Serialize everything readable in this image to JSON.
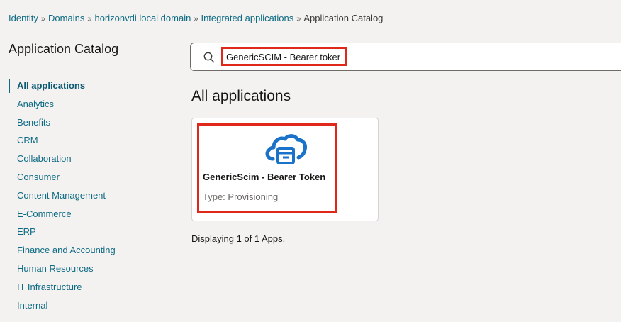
{
  "breadcrumb": {
    "items": [
      "Identity",
      "Domains",
      "horizonvdi.local domain",
      "Integrated applications"
    ],
    "current": "Application Catalog",
    "separator": "»"
  },
  "sidebar": {
    "title": "Application Catalog",
    "items": [
      {
        "label": "All applications",
        "active": true
      },
      {
        "label": "Analytics"
      },
      {
        "label": "Benefits"
      },
      {
        "label": "CRM"
      },
      {
        "label": "Collaboration"
      },
      {
        "label": "Consumer"
      },
      {
        "label": "Content Management"
      },
      {
        "label": "E-Commerce"
      },
      {
        "label": "ERP"
      },
      {
        "label": "Finance and Accounting"
      },
      {
        "label": "Human Resources"
      },
      {
        "label": "IT Infrastructure"
      },
      {
        "label": "Internal"
      }
    ]
  },
  "search": {
    "value": "GenericSCIM - Bearer token",
    "icon": "search-icon"
  },
  "main": {
    "title": "All applications",
    "apps": [
      {
        "name": "GenericScim - Bearer Token",
        "type": "Type: Provisioning",
        "icon": "cloud-app-icon"
      }
    ],
    "count_text": "Displaying 1 of 1 Apps."
  },
  "colors": {
    "link": "#0f6b84",
    "highlight": "#e0281a",
    "icon_blue": "#1a73c9",
    "background": "#f3f2f0"
  }
}
